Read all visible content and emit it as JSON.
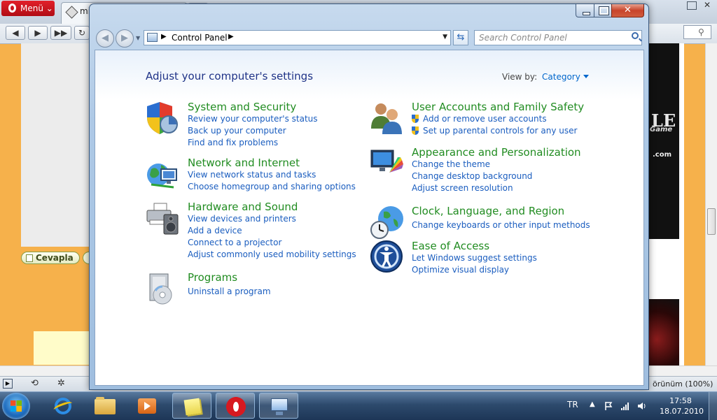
{
  "browser": {
    "menu_label": "Menü",
    "tab_title": "mi",
    "reply_button": "Cevapla",
    "zoom_status": "örünüm (100%)",
    "ad": {
      "brand_text": "LE",
      "game_text": "Game",
      "domain_text": ".com"
    }
  },
  "control_panel": {
    "breadcrumb": "Control Panel",
    "search_placeholder": "Search Control Panel",
    "heading": "Adjust your computer's settings",
    "view_by_label": "View by:",
    "view_by_value": "Category",
    "categories": [
      {
        "title": "System and Security",
        "icon": "shield-icon",
        "links": [
          "Review your computer's status",
          "Back up your computer",
          "Find and fix problems"
        ]
      },
      {
        "title": "Network and Internet",
        "icon": "network-globe-icon",
        "links": [
          "View network status and tasks",
          "Choose homegroup and sharing options"
        ]
      },
      {
        "title": "Hardware and Sound",
        "icon": "printer-speaker-icon",
        "links": [
          "View devices and printers",
          "Add a device",
          "Connect to a projector",
          "Adjust commonly used mobility settings"
        ]
      },
      {
        "title": "Programs",
        "icon": "programs-disc-icon",
        "links": [
          "Uninstall a program"
        ]
      },
      {
        "title": "User Accounts and Family Safety",
        "icon": "users-icon",
        "links": [
          "Add or remove user accounts",
          "Set up parental controls for any user"
        ]
      },
      {
        "title": "Appearance and Personalization",
        "icon": "monitor-palette-icon",
        "links": [
          "Change the theme",
          "Change desktop background",
          "Adjust screen resolution"
        ]
      },
      {
        "title": "Clock, Language, and Region",
        "icon": "clock-globe-icon",
        "links": [
          "Change keyboards or other input methods"
        ]
      },
      {
        "title": "Ease of Access",
        "icon": "ease-of-access-icon",
        "links": [
          "Let Windows suggest settings",
          "Optimize visual display"
        ]
      }
    ]
  },
  "taskbar": {
    "language": "TR",
    "time": "17:58",
    "date": "18.07.2010",
    "apps": [
      "internet-explorer",
      "windows-explorer",
      "windows-media-player",
      "sticky-notes",
      "opera",
      "control-panel"
    ]
  },
  "colors": {
    "category_title": "#218c21",
    "link": "#1a5dbf",
    "heading": "#1e3287",
    "page_background": "#f6b14b"
  }
}
